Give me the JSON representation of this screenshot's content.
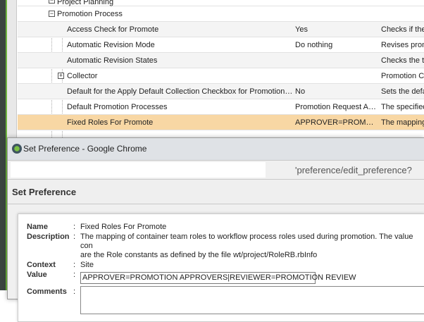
{
  "tree": {
    "partial_top": "Project Planning",
    "group": "Promotion Process",
    "rows": [
      {
        "name": "Access Check for Promote",
        "value": "Yes",
        "desc": "Checks if the"
      },
      {
        "name": "Automatic Revision Mode",
        "value": "Do nothing",
        "desc": "Revises prom"
      },
      {
        "name": "Automatic Revision States",
        "value": "",
        "desc": "Checks the t"
      },
      {
        "name": "Collector",
        "value": "",
        "desc": "Promotion C"
      },
      {
        "name": "Default for the Apply Default Collection Checkbox for Promotion…",
        "value": "No",
        "desc": "Sets the defa"
      },
      {
        "name": "Default Promotion Processes",
        "value": "Promotion Request A…",
        "desc": "The specified"
      },
      {
        "name": "Fixed Roles For Promote",
        "value": "APPROVER=PROM…",
        "desc": "The mapping"
      }
    ]
  },
  "dialog": {
    "window_title": "Set Preference - Google Chrome",
    "url": "'preference/edit_preference?",
    "heading": "Set Preference",
    "labels": {
      "name": "Name",
      "description": "Description",
      "context": "Context",
      "value": "Value",
      "comments": "Comments",
      "colon": ":"
    },
    "name": "Fixed Roles For Promote",
    "description_line1": "The mapping of container team roles to workflow process roles used during promotion. The value con",
    "description_line2": "are the Role constants as defined by the file wt/project/RoleRB.rbInfo",
    "context": "Site",
    "value": "APPROVER=PROMOTION APPROVERS|REVIEWER=PROMOTION REVIEW",
    "comments": ""
  },
  "colors": {
    "selected_row": "#f8d7a4",
    "accent_green": "#6cb33f"
  }
}
